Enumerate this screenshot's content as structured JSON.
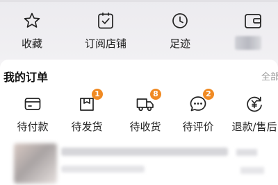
{
  "quick_access": [
    {
      "label": "收藏",
      "icon": "star-icon"
    },
    {
      "label": "订阅店铺",
      "icon": "subscribe-store-icon"
    },
    {
      "label": "足迹",
      "icon": "clock-icon"
    },
    {
      "label": "",
      "icon": "wallet-icon"
    }
  ],
  "orders": {
    "title": "我的订单",
    "all_label": "全部",
    "items": [
      {
        "label": "待付款",
        "icon": "card-icon",
        "badge": null
      },
      {
        "label": "待发货",
        "icon": "package-icon",
        "badge": "1"
      },
      {
        "label": "待收货",
        "icon": "truck-icon",
        "badge": "8"
      },
      {
        "label": "待评价",
        "icon": "comment-icon",
        "badge": "2"
      },
      {
        "label": "退款/售后",
        "icon": "refund-icon",
        "badge": null
      }
    ]
  },
  "colors": {
    "badge": "#f08a23",
    "card": "#ffffff",
    "background": "#f4f3f5"
  }
}
